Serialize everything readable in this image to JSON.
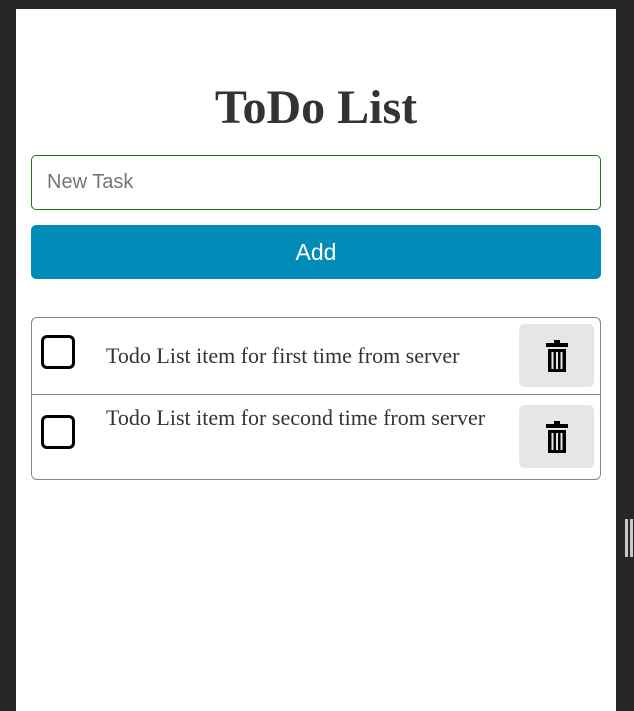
{
  "app": {
    "title": "ToDo List"
  },
  "new_task": {
    "placeholder": "New Task",
    "value": ""
  },
  "add_button": {
    "label": "Add"
  },
  "todos": [
    {
      "text": "Todo List item for first time from server",
      "checked": false
    },
    {
      "text": "Todo List item for second time from server",
      "checked": false
    }
  ],
  "icons": {
    "delete": "trash-icon",
    "complete": "checkbox"
  },
  "colors": {
    "background": "#262626",
    "add_button": "#008bb9",
    "input_border": "#1a7a1a",
    "delete_button": "#e6e6e6",
    "text": "#333333"
  }
}
